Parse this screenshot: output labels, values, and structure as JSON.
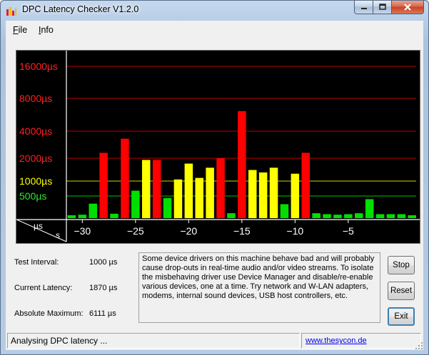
{
  "window": {
    "title": "DPC Latency Checker V1.2.0"
  },
  "menu": [
    {
      "key": "F",
      "rest": "ile"
    },
    {
      "key": "I",
      "rest": "nfo"
    }
  ],
  "chart_data": {
    "type": "bar",
    "title": "",
    "ylabels": [
      "16000µs",
      "8000µs",
      "4000µs",
      "2000µs",
      "1000µs",
      "500µs"
    ],
    "ylabel_colors": [
      "#ff2020",
      "#ff2020",
      "#ff2020",
      "#ff2020",
      "#ffff00",
      "#2ee82e"
    ],
    "xtick_labels": [
      "−30",
      "−25",
      "−20",
      "−15",
      "−10",
      "−5"
    ],
    "xtick_values": [
      -30,
      -25,
      -20,
      -15,
      -10,
      -5
    ],
    "corner_labels": [
      "µs",
      "s"
    ],
    "x_range": [
      -31.5,
      0
    ],
    "y_scale": "log2",
    "y_range_us": [
      125,
      26000
    ],
    "colors": {
      "green": "#00e000",
      "yellow": "#ffff00",
      "red": "#ff0000"
    },
    "bars": [
      {
        "x": -31,
        "value_us": 150,
        "color": "green"
      },
      {
        "x": -30,
        "value_us": 155,
        "color": "green"
      },
      {
        "x": -29,
        "value_us": 310,
        "color": "green"
      },
      {
        "x": -28,
        "value_us": 2300,
        "color": "red"
      },
      {
        "x": -27,
        "value_us": 165,
        "color": "green"
      },
      {
        "x": -26,
        "value_us": 3300,
        "color": "red"
      },
      {
        "x": -25,
        "value_us": 640,
        "color": "green"
      },
      {
        "x": -24,
        "value_us": 1900,
        "color": "yellow"
      },
      {
        "x": -23,
        "value_us": 1900,
        "color": "red"
      },
      {
        "x": -22,
        "value_us": 440,
        "color": "green"
      },
      {
        "x": -21,
        "value_us": 1050,
        "color": "yellow"
      },
      {
        "x": -20,
        "value_us": 1700,
        "color": "yellow"
      },
      {
        "x": -19,
        "value_us": 1100,
        "color": "yellow"
      },
      {
        "x": -18,
        "value_us": 1500,
        "color": "yellow"
      },
      {
        "x": -17,
        "value_us": 2000,
        "color": "red"
      },
      {
        "x": -16,
        "value_us": 170,
        "color": "green"
      },
      {
        "x": -15,
        "value_us": 6111,
        "color": "red"
      },
      {
        "x": -14,
        "value_us": 1400,
        "color": "yellow"
      },
      {
        "x": -13,
        "value_us": 1300,
        "color": "yellow"
      },
      {
        "x": -12,
        "value_us": 1500,
        "color": "yellow"
      },
      {
        "x": -11,
        "value_us": 300,
        "color": "green"
      },
      {
        "x": -10,
        "value_us": 1250,
        "color": "yellow"
      },
      {
        "x": -9,
        "value_us": 2300,
        "color": "red"
      },
      {
        "x": -8,
        "value_us": 170,
        "color": "green"
      },
      {
        "x": -7,
        "value_us": 160,
        "color": "green"
      },
      {
        "x": -6,
        "value_us": 155,
        "color": "green"
      },
      {
        "x": -5,
        "value_us": 160,
        "color": "green"
      },
      {
        "x": -4,
        "value_us": 170,
        "color": "green"
      },
      {
        "x": -3,
        "value_us": 410,
        "color": "green"
      },
      {
        "x": -2,
        "value_us": 160,
        "color": "green"
      },
      {
        "x": -1,
        "value_us": 160,
        "color": "green"
      },
      {
        "x": 0,
        "value_us": 160,
        "color": "green"
      },
      {
        "x": 1,
        "value_us": 150,
        "color": "green"
      }
    ],
    "threshold_lines": [
      {
        "label_index": 0,
        "color": "#c00000"
      },
      {
        "label_index": 1,
        "color": "#c00000"
      },
      {
        "label_index": 2,
        "color": "#c00000"
      },
      {
        "label_index": 3,
        "color": "#c00000"
      },
      {
        "label_index": 4,
        "color": "#d0d000"
      },
      {
        "label_index": 5,
        "color": "#00c000"
      }
    ]
  },
  "info": {
    "test_interval_label": "Test Interval:",
    "test_interval_value": "1000 µs",
    "current_latency_label": "Current Latency:",
    "current_latency_value": "1870 µs",
    "absolute_max_label": "Absolute Maximum:",
    "absolute_max_value": "6111 µs",
    "message": "Some device drivers on this machine behave bad and will probably cause drop-outs in real-time audio and/or video streams. To isolate the misbehaving driver use Device Manager and disable/re-enable various devices, one at a time. Try network and W-LAN adapters, modems, internal sound devices, USB host controllers, etc."
  },
  "buttons": {
    "stop": "Stop",
    "reset": "Reset",
    "exit": "Exit"
  },
  "status": {
    "text": "Analysing DPC latency ...",
    "link": "www.thesycon.de"
  }
}
